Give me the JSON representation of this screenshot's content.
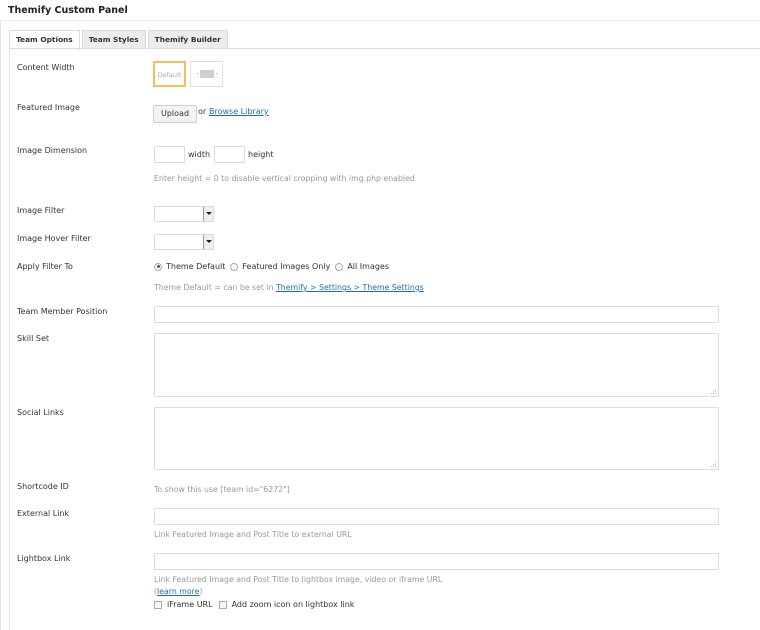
{
  "panel": {
    "title": "Themify Custom Panel"
  },
  "tabs": [
    {
      "label": "Team Options",
      "active": true
    },
    {
      "label": "Team Styles",
      "active": false
    },
    {
      "label": "Themify Builder",
      "active": false
    }
  ],
  "fields": {
    "content_width": {
      "label": "Content Width",
      "options": [
        {
          "name": "default",
          "label": "Default",
          "selected": true
        },
        {
          "name": "fullwidth",
          "label": "",
          "selected": false
        }
      ]
    },
    "featured_image": {
      "label": "Featured Image",
      "upload_label": "Upload",
      "or_text": "or",
      "browse_label": "Browse Library"
    },
    "image_dimension": {
      "label": "Image Dimension",
      "width_value": "",
      "width_label": "width",
      "height_value": "",
      "height_label": "height",
      "hint": "Enter height = 0 to disable vertical cropping with img.php enabled"
    },
    "image_filter": {
      "label": "Image Filter",
      "selected": ""
    },
    "image_hover_filter": {
      "label": "Image Hover Filter",
      "selected": ""
    },
    "apply_filter_to": {
      "label": "Apply Filter To",
      "options": [
        {
          "label": "Theme Default",
          "checked": true
        },
        {
          "label": "Featured Images Only",
          "checked": false
        },
        {
          "label": "All Images",
          "checked": false
        }
      ],
      "hint_prefix": "Theme Default = can be set in",
      "hint_link": "Themify > Settings > Theme Settings"
    },
    "team_member_position": {
      "label": "Team Member Position",
      "value": ""
    },
    "skill_set": {
      "label": "Skill Set",
      "value": ""
    },
    "social_links": {
      "label": "Social Links",
      "value": ""
    },
    "shortcode_id": {
      "label": "Shortcode ID",
      "hint": "To show this use [team id=\"6272\"]"
    },
    "external_link": {
      "label": "External Link",
      "value": "",
      "hint": "Link Featured Image and Post Title to external URL"
    },
    "lightbox_link": {
      "label": "Lightbox Link",
      "value": "",
      "hint": "Link Featured Image and Post Title to lightbox image, video or iframe URL",
      "learn_more_open": "(",
      "learn_more": "learn more",
      "learn_more_close": ")",
      "checkboxes": [
        {
          "label": "iFrame URL",
          "checked": false
        },
        {
          "label": "Add zoom icon on lightbox link",
          "checked": false
        }
      ]
    }
  }
}
